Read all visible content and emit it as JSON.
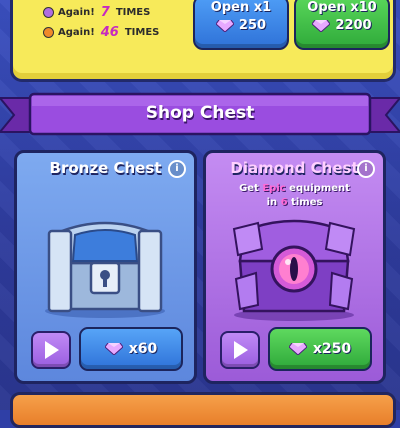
{
  "top_panel": {
    "rows": [
      {
        "label": "Again!",
        "count": "7",
        "suffix": "TIMES",
        "dot": "purple"
      },
      {
        "label": "Again!",
        "count": "46",
        "suffix": "TIMES",
        "dot": "orange"
      }
    ],
    "open_x1": {
      "label": "Open x1",
      "price": "250"
    },
    "open_x10": {
      "label": "Open x10",
      "price": "2200"
    }
  },
  "shop": {
    "title": "Shop Chest"
  },
  "cards": {
    "bronze": {
      "title": "Bronze Chest",
      "price": "x60"
    },
    "diamond": {
      "title": "Diamond Chest",
      "desc_pre": "Get ",
      "desc_highlight": "Epic",
      "desc_post": " equipment",
      "desc_line2_pre": "in ",
      "desc_line2_num": "6",
      "desc_line2_post": " times",
      "price": "x250"
    }
  },
  "colors": {
    "gem": "#c77bf0",
    "panel_yellow": "#f7ea5a",
    "ribbon": "#8a3fd6",
    "count_pink": "#c62ac0"
  }
}
